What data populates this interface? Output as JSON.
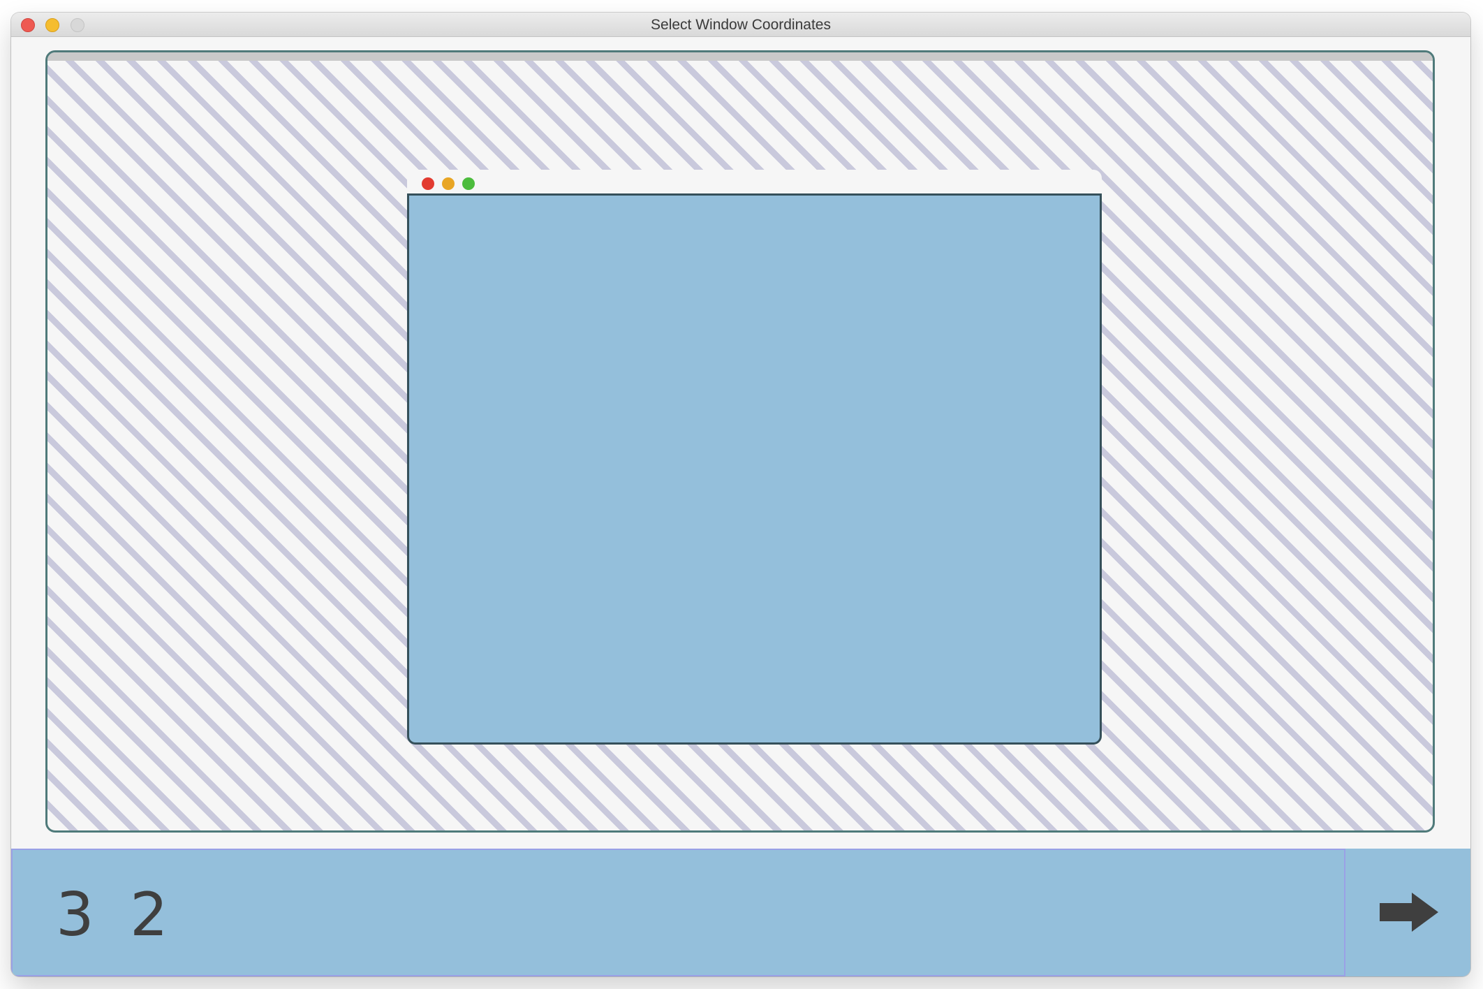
{
  "window": {
    "title": "Select Window Coordinates"
  },
  "colors": {
    "stripe": "#c9c9dc",
    "background": "#f6f6f6",
    "accent": "#94bfdb",
    "border": "#4f7a7a",
    "text": "#3f3f3f"
  },
  "coordinates": {
    "x": "3",
    "y": "2"
  },
  "icons": {
    "next": "right-arrow-icon"
  }
}
